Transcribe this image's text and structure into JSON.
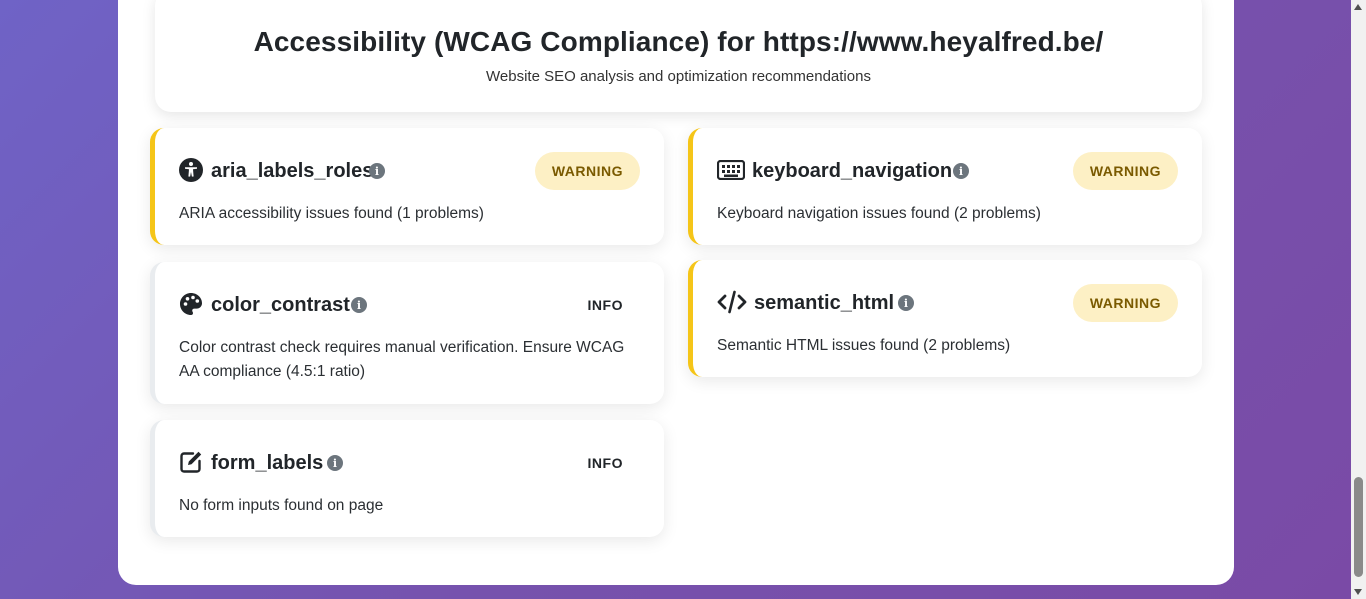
{
  "header": {
    "title": "Accessibility (WCAG Compliance) for https://www.heyalfred.be/",
    "subtitle": "Website SEO analysis and optimization recommendations"
  },
  "colors": {
    "warning_accent": "#f5c518",
    "warning_badge_bg": "#fdf0c5",
    "info_icon": "#6c757d",
    "background_gradient_start": "#6f63c6",
    "background_gradient_end": "#7a4aa6"
  },
  "checks": [
    {
      "id": "aria_labels_roles",
      "icon": "universal-access-icon",
      "title": "aria_labels_roles",
      "status": "WARNING",
      "description": "ARIA accessibility issues found (1 problems)"
    },
    {
      "id": "keyboard_navigation",
      "icon": "keyboard-icon",
      "title": "keyboard_navigation",
      "status": "WARNING",
      "description": "Keyboard navigation issues found (2 problems)"
    },
    {
      "id": "color_contrast",
      "icon": "palette-icon",
      "title": "color_contrast",
      "status": "INFO",
      "description": "Color contrast check requires manual verification. Ensure WCAG AA compliance (4.5:1 ratio)"
    },
    {
      "id": "semantic_html",
      "icon": "code-icon",
      "title": "semantic_html",
      "status": "WARNING",
      "description": "Semantic HTML issues found (2 problems)"
    },
    {
      "id": "form_labels",
      "icon": "edit-icon",
      "title": "form_labels",
      "status": "INFO",
      "description": "No form inputs found on page"
    }
  ],
  "info_icon_glyph": "i"
}
